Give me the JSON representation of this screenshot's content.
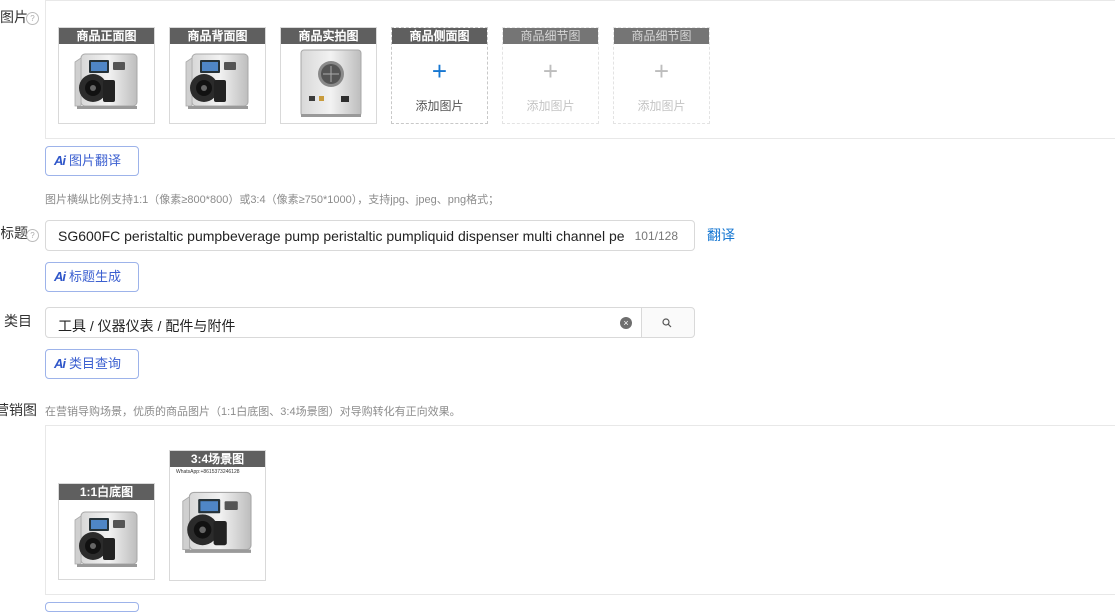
{
  "images_field": {
    "label": "图片",
    "slots": [
      {
        "caption": "商品正面图",
        "filled": true
      },
      {
        "caption": "商品背面图",
        "filled": true
      },
      {
        "caption": "商品实拍图",
        "filled": true
      },
      {
        "caption": "商品侧面图",
        "filled": false,
        "add_label": "添加图片"
      },
      {
        "caption": "商品细节图",
        "filled": false,
        "add_label": "添加图片"
      },
      {
        "caption": "商品细节图",
        "filled": false,
        "add_label": "添加图片"
      }
    ],
    "ai_translate_label": "图片翻译",
    "hint": "图片横纵比例支持1:1（像素≥800*800）或3:4（像素≥750*1000），支持jpg、jpeg、png格式；"
  },
  "title_field": {
    "label": "标题",
    "value": "SG600FC peristaltic pumpbeverage pump peristaltic pumpliquid dispenser multi channel pe",
    "counter": "101/128",
    "translate_label": "翻译",
    "ai_generate_label": "标题生成"
  },
  "category_field": {
    "label": "类目",
    "value": "工具 / 仪器仪表 / 配件与附件",
    "ai_query_label": "类目查询"
  },
  "marketing_field": {
    "label": "营销图",
    "hint": "在营销导购场景，优质的商品图片（1:1白底图、3:4场景图）对导购转化有正向效果。",
    "slots": [
      {
        "caption": "1:1白底图"
      },
      {
        "caption": "3:4场景图",
        "overlay_text": "WhatsApp:+8615373246128"
      }
    ]
  },
  "icons": {
    "help": "help-icon",
    "plus": "plus-icon",
    "clear": "clear-icon",
    "search": "search-icon",
    "ai": "ai-icon"
  },
  "colors": {
    "accent": "#1677d2",
    "ai_blue": "#3b5fd0",
    "caption_bg": "#5f5f5f"
  }
}
